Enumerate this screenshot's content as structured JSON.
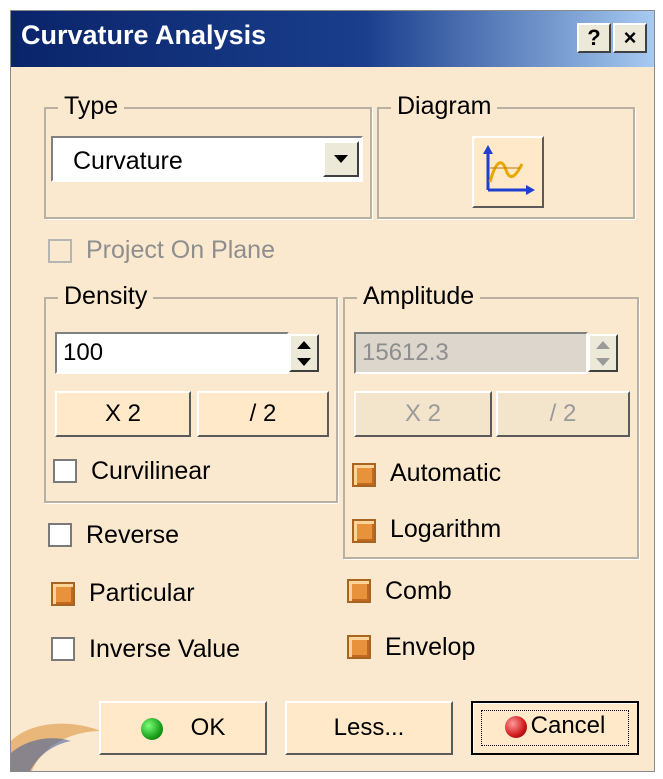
{
  "window": {
    "title": "Curvature Analysis",
    "help_label": "?",
    "close_label": "×"
  },
  "type_group": {
    "title": "Type",
    "selected": "Curvature"
  },
  "diagram_group": {
    "title": "Diagram",
    "icon": "curve-diagram-icon"
  },
  "project_on_plane": {
    "label": "Project On Plane",
    "checked": false,
    "enabled": false
  },
  "density": {
    "title": "Density",
    "value": "100",
    "x2_label": "X 2",
    "div2_label": "/ 2",
    "curvilinear_label": "Curvilinear"
  },
  "amplitude": {
    "title": "Amplitude",
    "value": "15612.3",
    "x2_label": "X 2",
    "div2_label": "/ 2",
    "automatic_label": "Automatic",
    "logarithm_label": "Logarithm"
  },
  "options": {
    "reverse_label": "Reverse",
    "particular_label": "Particular",
    "inverse_value_label": "Inverse Value",
    "comb_label": "Comb",
    "envelop_label": "Envelop"
  },
  "buttons": {
    "ok_label": "OK",
    "less_label": "Less...",
    "cancel_label": "Cancel"
  },
  "colors": {
    "title_start": "#0a246a",
    "title_end": "#a6caf0",
    "panel": "#fbe9cf",
    "light_on": "#e8933c",
    "ok_ball": "#1aa01a",
    "cancel_ball": "#d01818"
  }
}
